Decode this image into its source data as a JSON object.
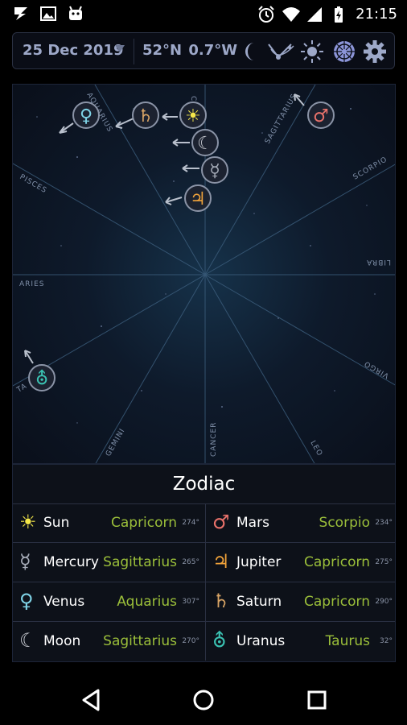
{
  "status_bar": {
    "time": "21:15",
    "left_icons": [
      "bolt-notification-icon",
      "image-notification-icon",
      "android-notification-icon"
    ],
    "right_icons": [
      "alarm-icon",
      "wifi-icon",
      "signal-icon",
      "battery-charging-icon"
    ]
  },
  "toolbar": {
    "date": "25 Dec 2019",
    "coords": "52°N  0.7°W",
    "buttons": [
      "moon-phase-icon",
      "telescope-icon",
      "sun-icon",
      "zodiac-wheel-icon",
      "settings-gear-icon"
    ]
  },
  "chart": {
    "zodiac_labels": [
      "AQUARIUS",
      "C",
      "SAGITTARIUS",
      "SCORPIO",
      "PISCES",
      "LIBRA",
      "ARIES",
      "VIRGO",
      "TA",
      "GEMINI",
      "CANCER",
      "LEO"
    ],
    "planet_symbols": {
      "venus": "♀",
      "saturn": "♄",
      "sun": "☀",
      "mars": "♂",
      "moon": "☾",
      "mercury": "☿",
      "jupiter": "♃",
      "uranus": "⛢"
    }
  },
  "panel": {
    "title": "Zodiac",
    "rows": [
      [
        {
          "name": "Sun",
          "sign": "Capricorn",
          "degree": "274°",
          "color": "#f5e84a",
          "symbol": "☀"
        },
        {
          "name": "Mars",
          "sign": "Scorpio",
          "degree": "234°",
          "color": "#e8716a",
          "symbol": "♂"
        }
      ],
      [
        {
          "name": "Mercury",
          "sign": "Sagittarius",
          "degree": "265°",
          "color": "#a6acb8",
          "symbol": "☿"
        },
        {
          "name": "Jupiter",
          "sign": "Capricorn",
          "degree": "275°",
          "color": "#f0a23a",
          "symbol": "♃"
        }
      ],
      [
        {
          "name": "Venus",
          "sign": "Aquarius",
          "degree": "307°",
          "color": "#7fd3e6",
          "symbol": "♀"
        },
        {
          "name": "Saturn",
          "sign": "Capricorn",
          "degree": "290°",
          "color": "#d9a566",
          "symbol": "♄"
        }
      ],
      [
        {
          "name": "Moon",
          "sign": "Sagittarius",
          "degree": "270°",
          "color": "#c9ccd3",
          "symbol": "☾"
        },
        {
          "name": "Uranus",
          "sign": "Taurus",
          "degree": "32°",
          "color": "#3bc3b3",
          "symbol": "⛢"
        }
      ]
    ]
  },
  "colors": {
    "sign_text": "#9bbf3a",
    "toolbar_text": "#9da8c8",
    "accent_zodiac_button": "#8c95d8"
  },
  "navbar": {
    "buttons": [
      "back-icon",
      "home-icon",
      "recents-icon"
    ]
  }
}
